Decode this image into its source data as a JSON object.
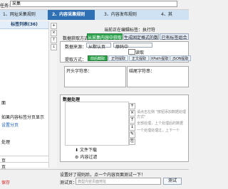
{
  "topbar": {
    "task_label": "任务:",
    "task_value": "采集"
  },
  "steps": [
    {
      "label": "1、网址采集规则"
    },
    {
      "label": "2、内容采集规则"
    },
    {
      "label": "3、内容发布规则"
    },
    {
      "label": "4、其"
    }
  ],
  "left_panel": {
    "header": "标签列表(36)",
    "tools": [
      "+",
      "×",
      "↑",
      "↓"
    ],
    "line1": "面",
    "line2": "如果内容标签分页显示",
    "line3": "设置分页",
    "line4": "处理",
    "footer_a": "页",
    "footer_b": "页"
  },
  "main": {
    "current_label": "当前正在编辑标签：执行符",
    "fetch_mode_label": "数据获取方式",
    "fetch_modes": [
      "从采集内容中获取数据",
      "生成固定格式的数据",
      "已有标签组合"
    ],
    "source_label": "数据来源：",
    "source_value": "从默认页",
    "source_value2": "原码中",
    "record_label": "读取",
    "extract_label": "提取方式：",
    "extract_tabs": [
      "前后截取",
      "正则提取",
      "正文提取",
      "XPath提取",
      "JSON提取"
    ],
    "start_label": "开头字符串：",
    "end_label": "结尾字符串：",
    "process_label": "数据处理",
    "process_hint1": "请点击左侧 \"按钮添加数据处理方式\"",
    "process_hint2": "全部处理，上个处理后的数据",
    "process_hint3": "一个处理处理过，上下一个",
    "download_label": "文件下载",
    "filter_label": "内容过滤",
    "test_hint": "设置好了规则后，点一个内容页面测试一下！",
    "test_label": "测试页：",
    "test_placeholder": "典型内容页面地址",
    "test_button": "测试"
  },
  "statusbar": {
    "save_label": "保存"
  }
}
